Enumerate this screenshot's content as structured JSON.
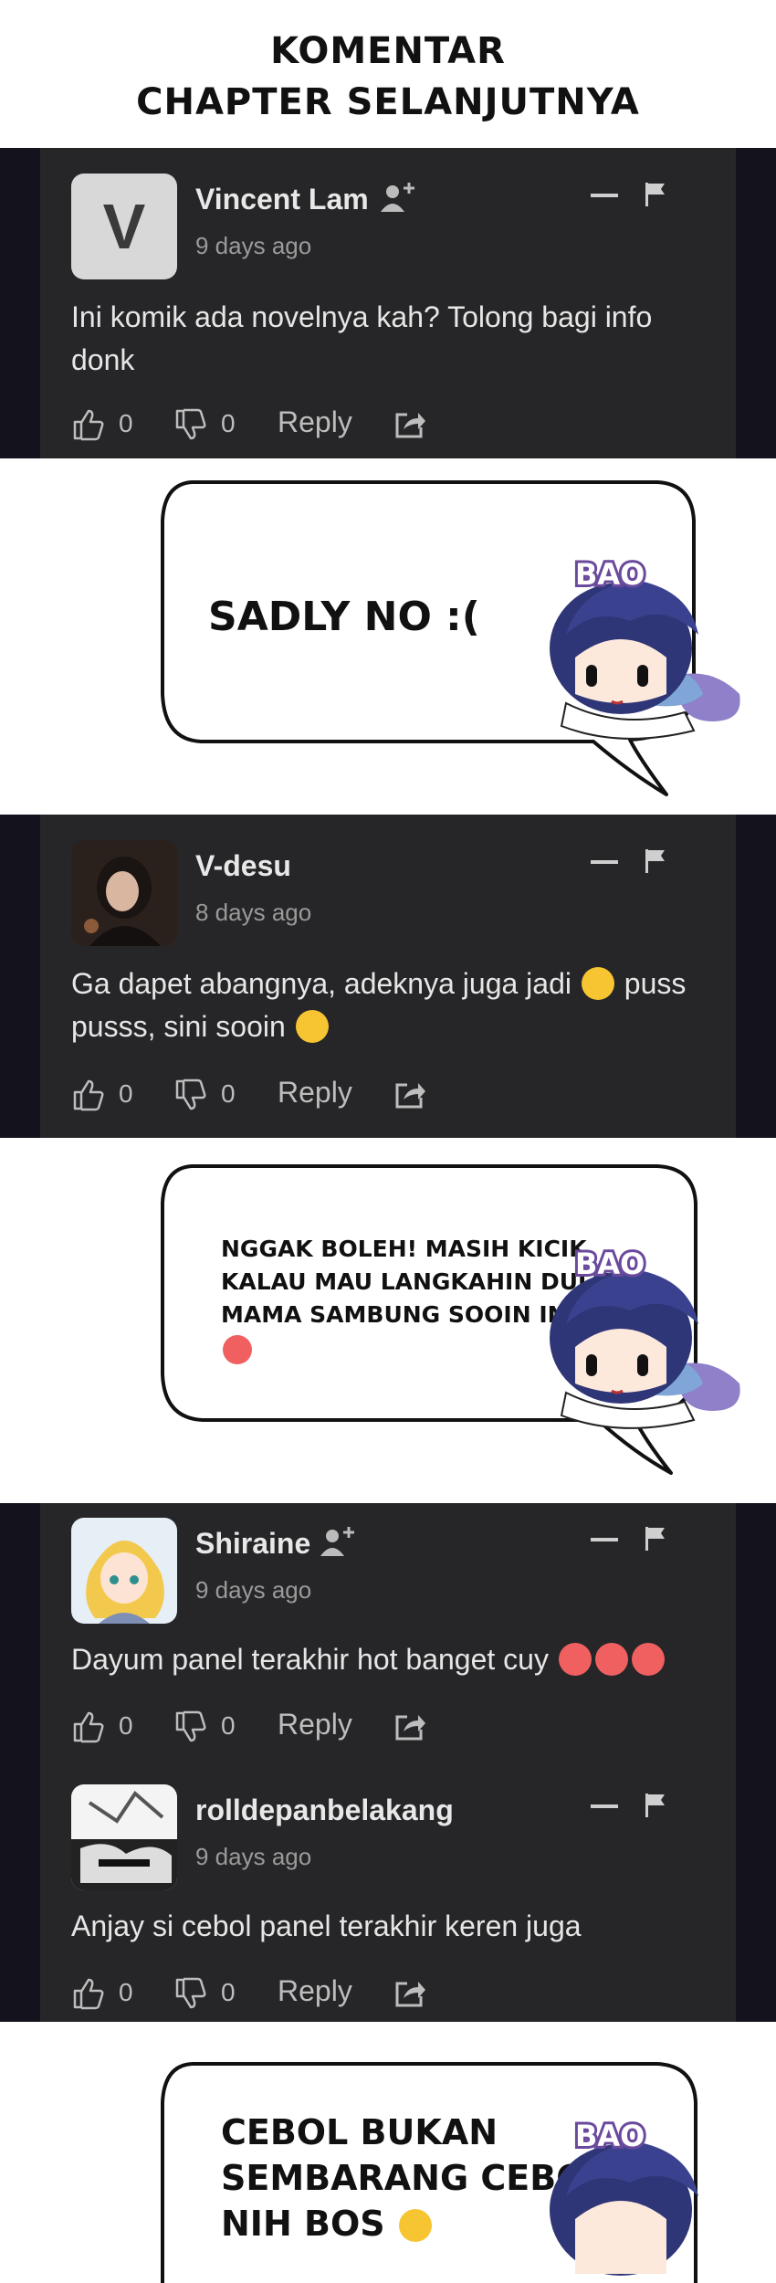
{
  "heading": {
    "line1": "KOMENTAR",
    "line2": "CHAPTER SELANJUTNYA"
  },
  "comments": [
    {
      "avatar_letter": "V",
      "name": "Vincent Lam",
      "time": "9 days ago",
      "text_line1": "Ini komik ada novelnya kah? Tolong bagi info",
      "text_line2": "donk",
      "likes": "0",
      "dislikes": "0",
      "reply": "Reply"
    },
    {
      "name": "V-desu",
      "time": "8 days ago",
      "text_line1_a": "Ga dapet abangnya, adeknya juga jadi",
      "text_line1_b": "puss",
      "text_line2": "pusss, sini sooin",
      "likes": "0",
      "dislikes": "0",
      "reply": "Reply"
    },
    {
      "name": "Shiraine",
      "time": "9 days ago",
      "text_line1": "Dayum panel terakhir hot banget cuy",
      "likes": "0",
      "dislikes": "0",
      "reply": "Reply"
    },
    {
      "name": "rolldepanbelakang",
      "time": "9 days ago",
      "text_line1": "Anjay si cebol panel terakhir keren juga",
      "likes": "0",
      "dislikes": "0",
      "reply": "Reply"
    }
  ],
  "bubbles": [
    {
      "text": "SADLY NO :(",
      "badge": "BAO"
    },
    {
      "line1": "NGGAK BOLEH! MASIH KICIK.",
      "line2": "KALAU MAU LANGKAHIN DULU",
      "line3": "MAMA SAMBUNG SOOIN INI",
      "badge": "BAO"
    },
    {
      "line1": "CEBOL BUKAN",
      "line2": "SEMBARANG CEBOL",
      "line3": "NIH BOS",
      "badge": "BAO"
    }
  ],
  "colors": {
    "outer_dark": "#14121c",
    "panel": "#262628",
    "text": "#e6e6e6",
    "muted": "#9a9a9a"
  },
  "icons": [
    "add-user-icon",
    "minus-icon",
    "flag-icon",
    "thumbs-up-icon",
    "thumbs-down-icon",
    "share-icon"
  ]
}
